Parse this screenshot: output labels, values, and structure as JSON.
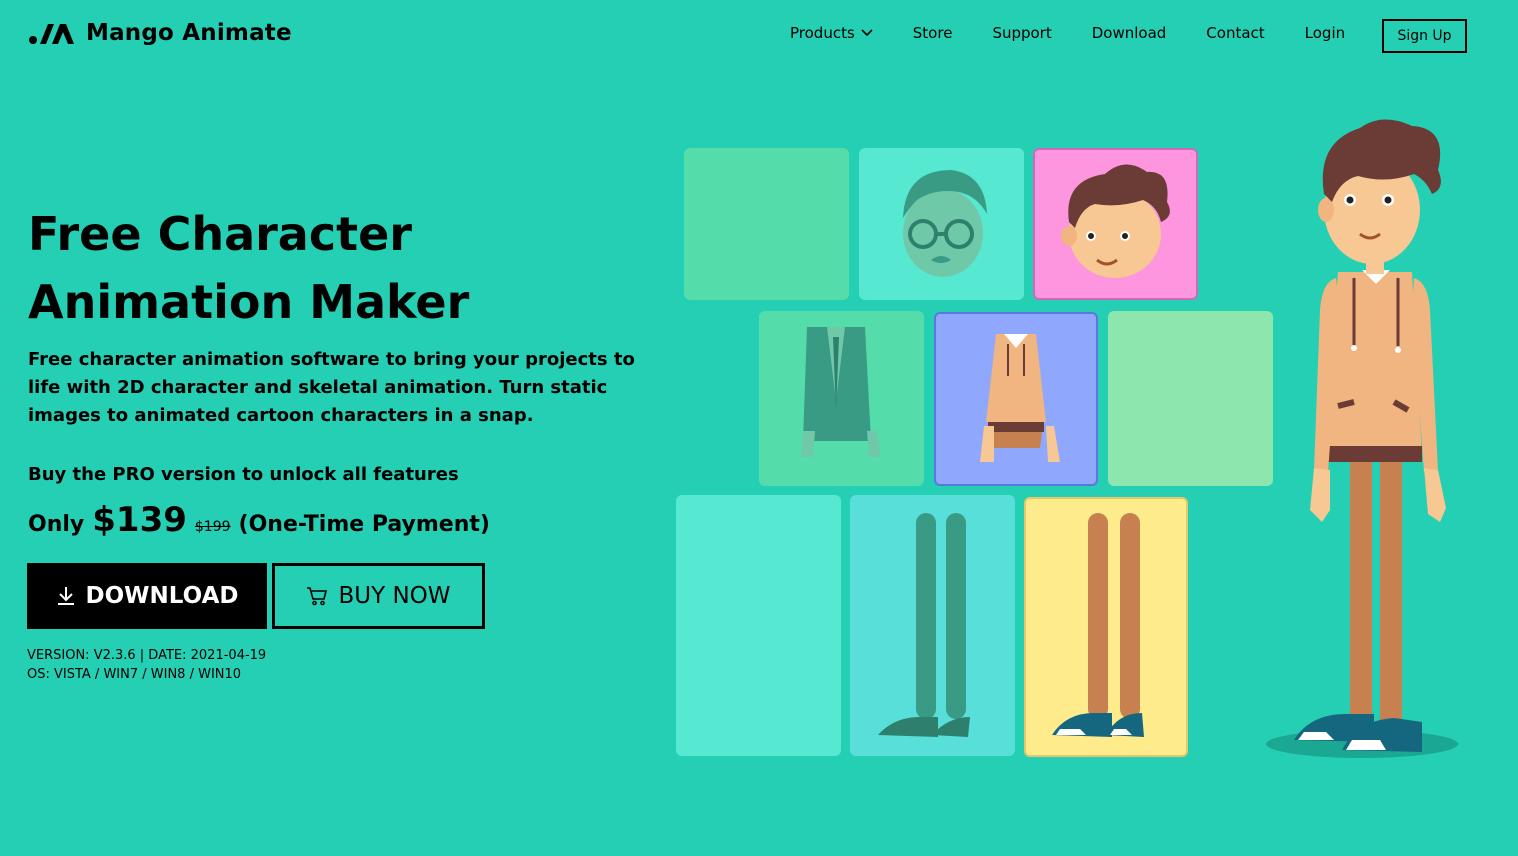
{
  "brand": {
    "name": "Mango Animate"
  },
  "nav": {
    "items": [
      {
        "label": "Products",
        "has_dropdown": true
      },
      {
        "label": "Store"
      },
      {
        "label": "Support"
      },
      {
        "label": "Download"
      },
      {
        "label": "Contact"
      },
      {
        "label": "Login"
      }
    ],
    "signup_label": "Sign Up"
  },
  "hero": {
    "title": "Free Character Animation Maker",
    "description": "Free character animation software to bring your projects to life with 2D character and skeletal animation. Turn static images to animated cartoon characters in a snap.",
    "pro_text": "Buy the PRO version to unlock all features",
    "price": {
      "prefix": "Only",
      "current": "$139",
      "old": "$199",
      "note": "(One-Time Payment)"
    },
    "download_label": "DOWNLOAD",
    "buy_label": "BUY NOW",
    "version_line": "VERSION: V2.3.6 | DATE: 2021-04-19",
    "os_line": "OS: VISTA / WIN7 / WIN8 / WIN10"
  },
  "icons": {
    "download": "download-arrow-icon",
    "cart": "shopping-cart-icon",
    "dropdown": "chevron-down-icon",
    "logo": "mango-logo-icon"
  },
  "colors": {
    "background": "#24cfb3",
    "tile_green": "#55dcab",
    "tile_mint": "#57e8d1",
    "tile_pink": "#fd96de",
    "tile_blue": "#8fa7fc",
    "tile_lightgreen": "#8ce6ae",
    "tile_cyan": "#59dfd9",
    "tile_yellow": "#fdeb8c",
    "skin": "#f7c893",
    "hair": "#6b3b35",
    "sweater": "#f0b580",
    "pants": "#c7804f",
    "shoe": "#15677f"
  }
}
